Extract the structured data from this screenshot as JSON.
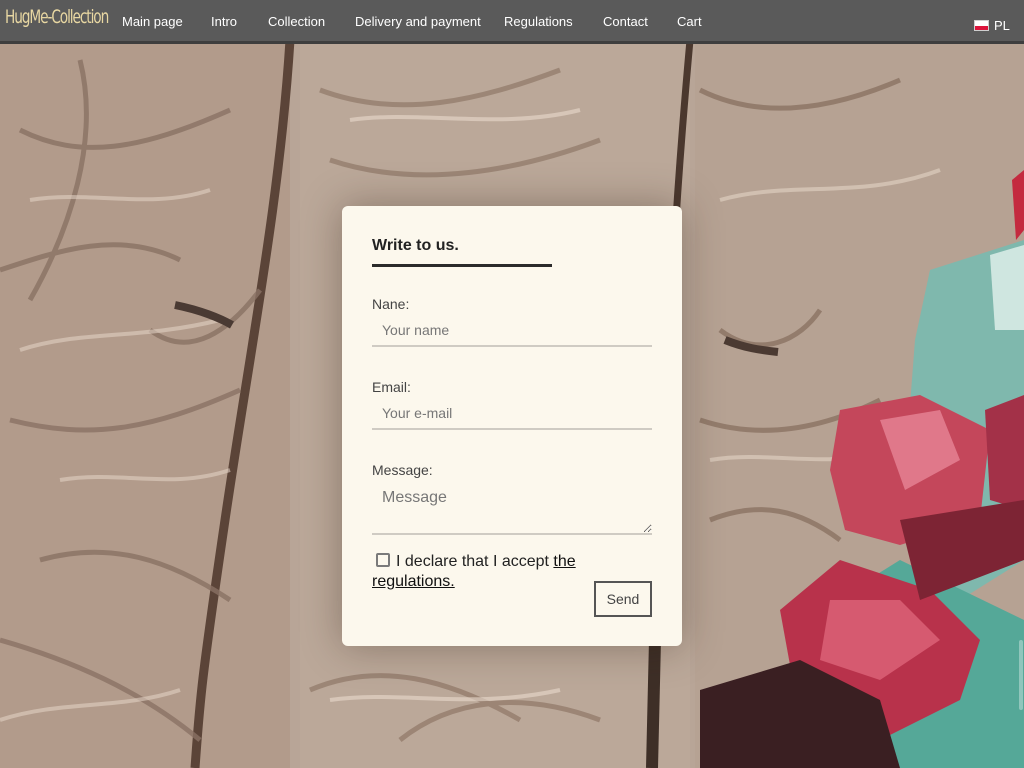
{
  "brand": {
    "logo": "HugMe-Collection"
  },
  "nav": {
    "items": [
      "Main page",
      "Intro",
      "Collection",
      "Delivery and payment",
      "Regulations",
      "Contact",
      "Cart"
    ],
    "language": "PL"
  },
  "contact_form": {
    "title": "Write to us.",
    "name_label": "Nane:",
    "name_placeholder": "Your name",
    "email_label": "Email:",
    "email_placeholder": "Your e-mail",
    "message_label": "Message:",
    "message_placeholder": "Message",
    "consent_text": "I declare that I accept ",
    "consent_link": "the regulations.",
    "consent_checked": false,
    "send_label": "Send"
  },
  "colors": {
    "nav_background": "#5a5a5a",
    "logo": "#e8d7a2",
    "card_background": "#fcf8ed",
    "flag_white": "#ffffff",
    "flag_red": "#dc143c"
  },
  "icons": [
    "poland-flag-icon",
    "checkbox-icon"
  ]
}
